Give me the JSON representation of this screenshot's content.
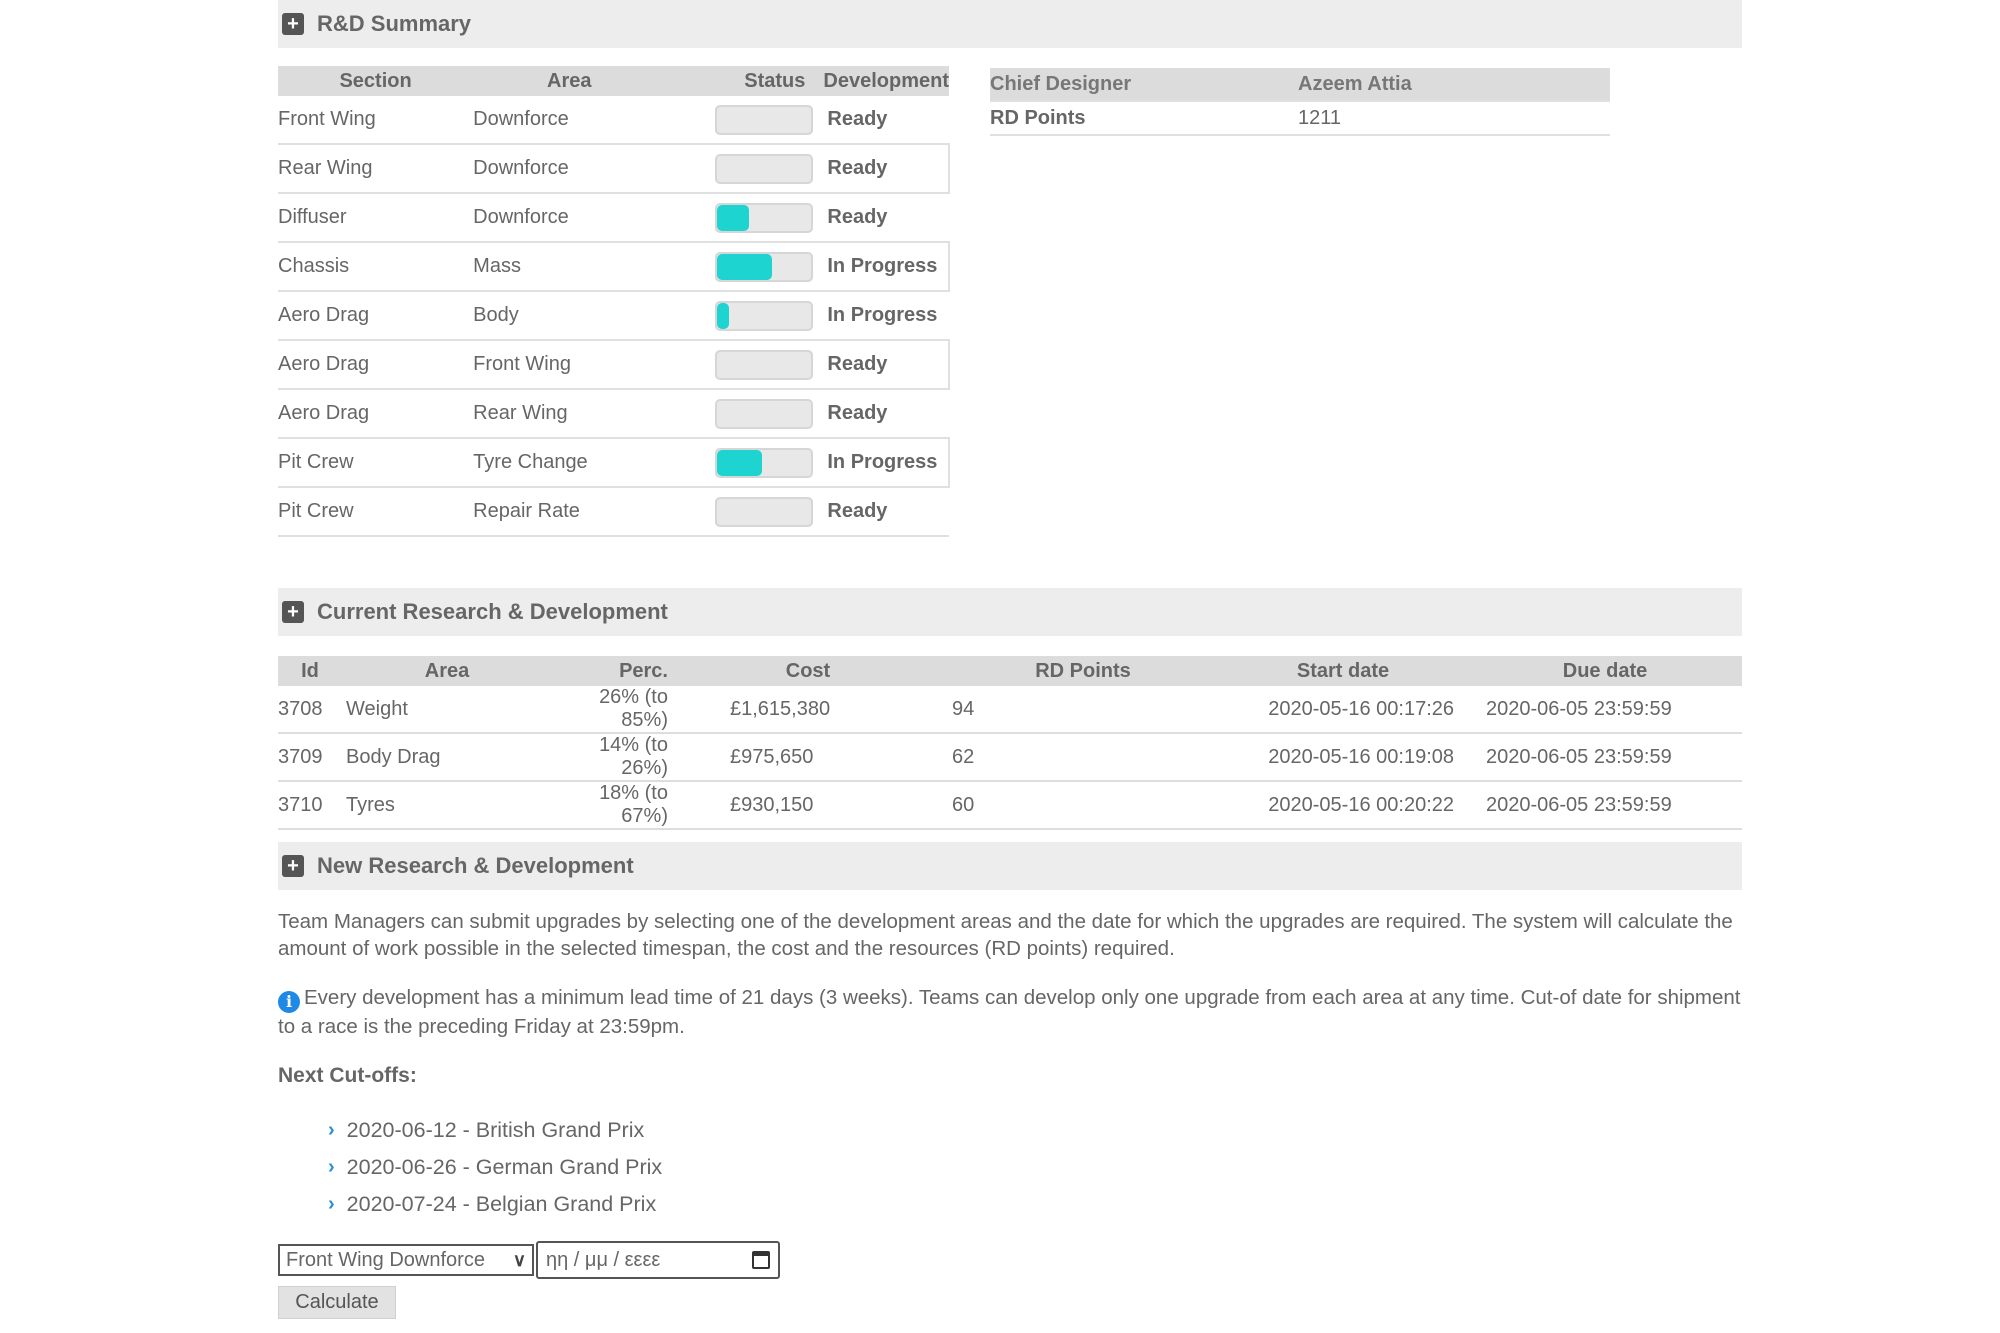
{
  "summary_section": {
    "title": "R&D Summary",
    "columns": [
      "Section",
      "Area",
      "Status",
      "Development"
    ],
    "rows": [
      {
        "section": "Front Wing",
        "area": "Downforce",
        "progress": 0,
        "development": "Ready",
        "state": "ready"
      },
      {
        "section": "Rear Wing",
        "area": "Downforce",
        "progress": 0,
        "development": "Ready",
        "state": "ready"
      },
      {
        "section": "Diffuser",
        "area": "Downforce",
        "progress": 0.34,
        "development": "Ready",
        "state": "ready"
      },
      {
        "section": "Chassis",
        "area": "Mass",
        "progress": 0.58,
        "development": "In Progress",
        "state": "progress"
      },
      {
        "section": "Aero Drag",
        "area": "Body",
        "progress": 0.12,
        "development": "In Progress",
        "state": "progress"
      },
      {
        "section": "Aero Drag",
        "area": "Front Wing",
        "progress": 0,
        "development": "Ready",
        "state": "ready"
      },
      {
        "section": "Aero Drag",
        "area": "Rear Wing",
        "progress": 0,
        "development": "Ready",
        "state": "ready"
      },
      {
        "section": "Pit Crew",
        "area": "Tyre Change",
        "progress": 0.47,
        "development": "In Progress",
        "state": "progress"
      },
      {
        "section": "Pit Crew",
        "area": "Repair Rate",
        "progress": 0,
        "development": "Ready",
        "state": "ready"
      }
    ],
    "info": {
      "chief_designer_label": "Chief Designer",
      "chief_designer_value": "Azeem Attia",
      "rd_points_label": "RD Points",
      "rd_points_value": "1211"
    }
  },
  "current_section": {
    "title": "Current Research & Development",
    "columns": [
      "Id",
      "Area",
      "Perc.",
      "Cost",
      "RD Points",
      "Start date",
      "Due date"
    ],
    "rows": [
      {
        "id": "3708",
        "area": "Weight",
        "perc": "26% (to 85%)",
        "cost": "£1,615,380",
        "rd_points": "94",
        "start": "2020-05-16 00:17:26",
        "due": "2020-06-05 23:59:59"
      },
      {
        "id": "3709",
        "area": "Body Drag",
        "perc": "14% (to 26%)",
        "cost": "£975,650",
        "rd_points": "62",
        "start": "2020-05-16 00:19:08",
        "due": "2020-06-05 23:59:59"
      },
      {
        "id": "3710",
        "area": "Tyres",
        "perc": "18% (to 67%)",
        "cost": "£930,150",
        "rd_points": "60",
        "start": "2020-05-16 00:20:22",
        "due": "2020-06-05 23:59:59"
      }
    ]
  },
  "new_section": {
    "title": "New Research & Development",
    "intro": "Team Managers can submit upgrades by selecting one of the development areas and the date for which the upgrades are required. The system will calculate the amount of work possible in the selected timespan, the cost and the resources (RD points) required.",
    "note": "Every development has a minimum lead time of 21 days (3 weeks). Teams can develop only one upgrade from each area at any time. Cut-of date for shipment to a race is the preceding Friday at 23:59pm.",
    "cutoffs_title": "Next Cut-offs:",
    "cutoffs": [
      "2020-06-12 - British Grand Prix",
      "2020-06-26 - German Grand Prix",
      "2020-07-24 - Belgian Grand Prix"
    ],
    "area_select_value": "Front Wing Downforce",
    "date_placeholder": "ηη / μμ / εεεε",
    "calculate_label": "Calculate"
  },
  "icons": {
    "plus": "+",
    "info": "i",
    "chevron_right": "›",
    "chevron_down": "⌄"
  },
  "colors": {
    "ready": "#2db52d",
    "in_progress": "#f0a500",
    "bar_fill": "#1dd4d0",
    "info_icon": "#1e8ae6"
  }
}
